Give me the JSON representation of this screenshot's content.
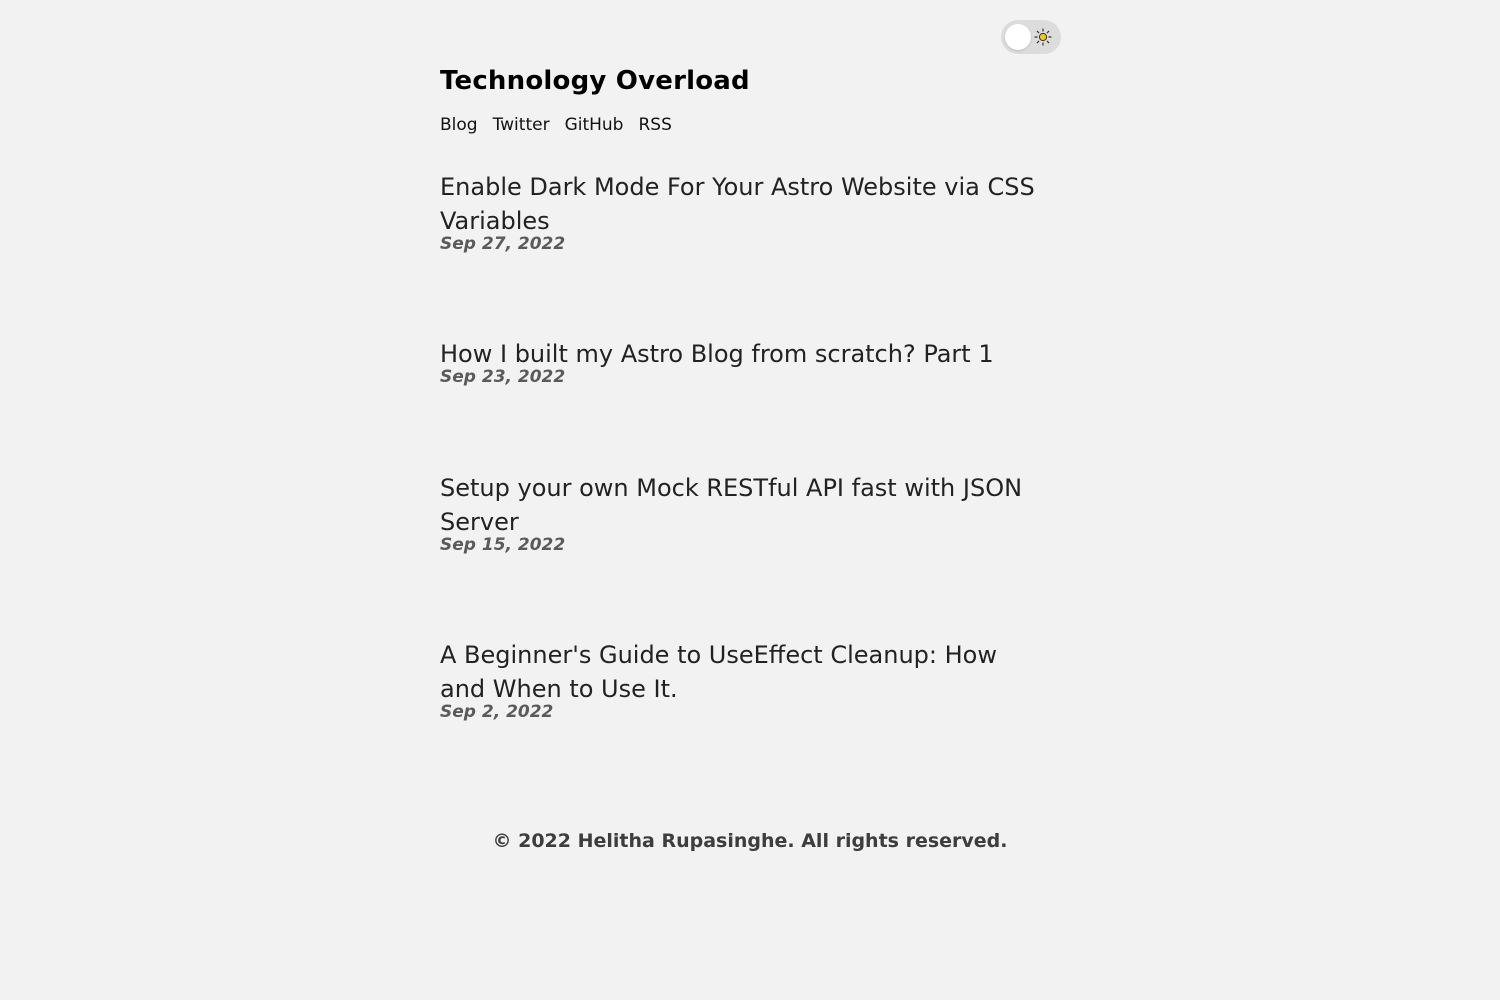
{
  "theme_toggle": {
    "state": "light",
    "icon": "sun-icon"
  },
  "header": {
    "title": "Technology Overload",
    "nav": [
      {
        "label": "Blog"
      },
      {
        "label": "Twitter"
      },
      {
        "label": "GitHub"
      },
      {
        "label": "RSS"
      }
    ]
  },
  "posts": [
    {
      "title": "Enable Dark Mode For Your Astro Website via CSS Variables",
      "date": "Sep 27, 2022"
    },
    {
      "title": "How I built my Astro Blog from scratch? Part 1",
      "date": "Sep 23, 2022"
    },
    {
      "title": "Setup your own Mock RESTful API fast with JSON Server",
      "date": "Sep 15, 2022"
    },
    {
      "title": "A Beginner's Guide to UseEffect Cleanup: How and When to Use It.",
      "date": "Sep 2, 2022"
    }
  ],
  "footer": {
    "text": "© 2022 Helitha Rupasinghe. All rights reserved."
  },
  "colors": {
    "background": "#f2f2f2",
    "toggle_track": "#dcdcdc",
    "date_text": "#5a5a5a"
  }
}
